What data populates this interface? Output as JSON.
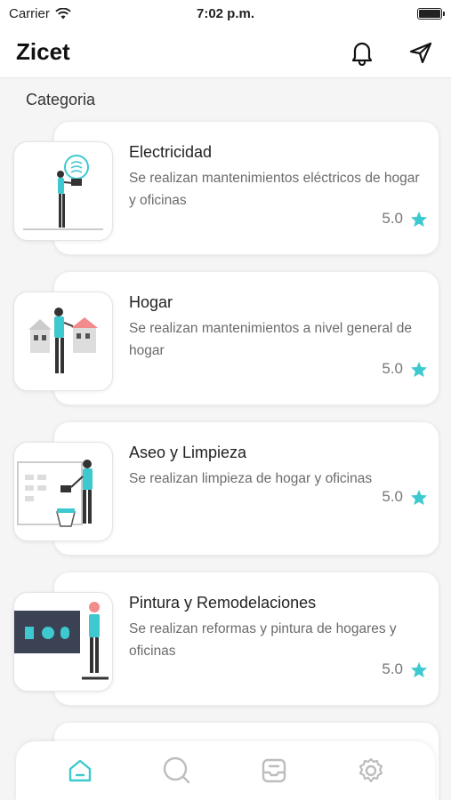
{
  "status_bar": {
    "carrier": "Carrier",
    "time": "7:02 p.m."
  },
  "header": {
    "title": "Zicet"
  },
  "section": {
    "title": "Categoria"
  },
  "categories": [
    {
      "title": "Electricidad",
      "description": "Se realizan mantenimientos eléctricos de hogar y oficinas",
      "rating": "5.0"
    },
    {
      "title": "Hogar",
      "description": "Se realizan mantenimientos a nivel general de hogar",
      "rating": "5.0"
    },
    {
      "title": "Aseo y Limpieza",
      "description": "Se realizan limpieza de hogar y oficinas",
      "rating": "5.0"
    },
    {
      "title": "Pintura y Remodelaciones",
      "description": "Se realizan reformas y pintura de hogares y oficinas",
      "rating": "5.0"
    }
  ],
  "colors": {
    "accent": "#3ec9d0",
    "star": "#3ec9d0",
    "inactive_tab": "#bdbdbd"
  },
  "tabs": [
    {
      "icon": "home-icon",
      "active": true
    },
    {
      "icon": "search-icon",
      "active": false
    },
    {
      "icon": "inbox-icon",
      "active": false
    },
    {
      "icon": "gear-icon",
      "active": false
    }
  ]
}
